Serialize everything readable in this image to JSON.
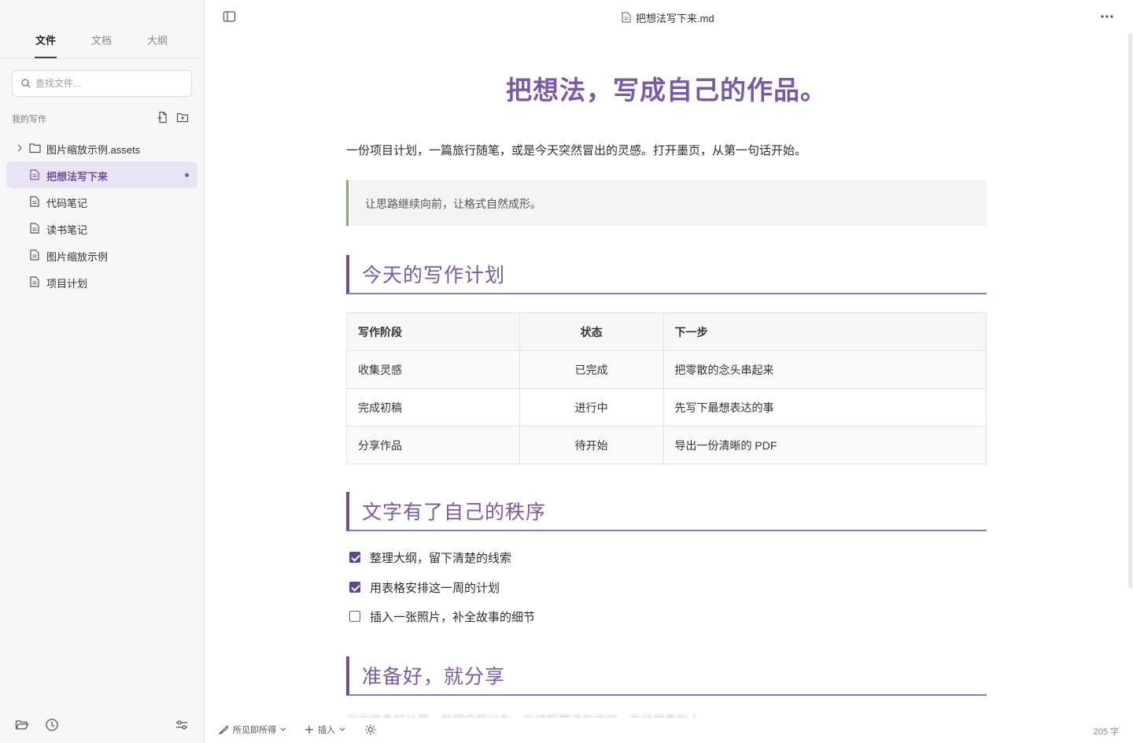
{
  "sidebar": {
    "tabs": [
      "文件",
      "文档",
      "大纲"
    ],
    "search_placeholder": "查找文件...",
    "workspace_label": "我的写作",
    "items": [
      {
        "label": "图片缩放示例.assets",
        "type": "folder"
      },
      {
        "label": "把想法写下来",
        "type": "file",
        "active": true
      },
      {
        "label": "代码笔记",
        "type": "file"
      },
      {
        "label": "读书笔记",
        "type": "file"
      },
      {
        "label": "图片缩放示例",
        "type": "file"
      },
      {
        "label": "项目计划",
        "type": "file"
      }
    ]
  },
  "header": {
    "doc_filename": "把想法写下来.md"
  },
  "document": {
    "title": "把想法，写成自己的作品。",
    "intro": "一份项目计划，一篇旅行随笔，或是今天突然冒出的灵感。打开墨页，从第一句话开始。",
    "quote": "让思路继续向前，让格式自然成形。",
    "section1": "今天的写作计划",
    "table": {
      "headers": [
        "写作阶段",
        "状态",
        "下一步"
      ],
      "rows": [
        [
          "收集灵感",
          "已完成",
          "把零散的念头串起来"
        ],
        [
          "完成初稿",
          "进行中",
          "先写下最想表达的事"
        ],
        [
          "分享作品",
          "待开始",
          "导出一份清晰的 PDF"
        ]
      ]
    },
    "section2": "文字有了自己的秩序",
    "tasks": [
      {
        "label": "整理大纲，留下清楚的线索",
        "checked": true
      },
      {
        "label": "用表格安排这一周的计划",
        "checked": true
      },
      {
        "label": "插入一张照片，补全故事的细节",
        "checked": false
      }
    ],
    "section3": "准备好，就分享",
    "faded_line": "当你准备好分享，就把它导出为一份排版整洁的文档，发给想看的人。"
  },
  "statusbar": {
    "mode_label": "所见即所得",
    "insert_label": "插入",
    "word_count": "205 字"
  },
  "colors": {
    "accent": "#7a5aa8",
    "accent_dark": "#5f4690",
    "quote_border": "#8fa284",
    "active_bg": "#e9e4f3"
  }
}
